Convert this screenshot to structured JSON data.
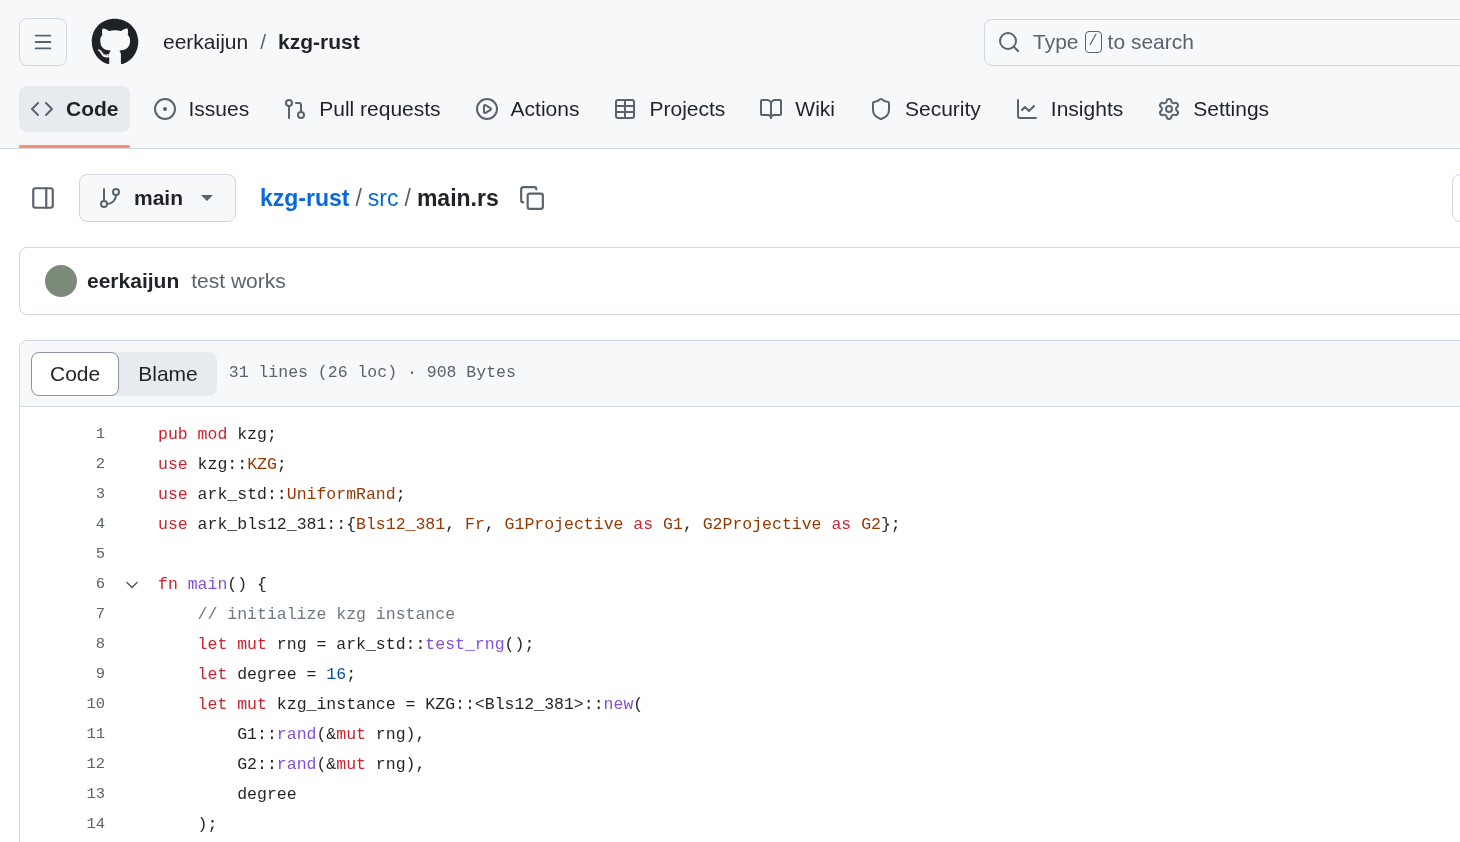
{
  "header": {
    "owner": "eerkaijun",
    "separator": "/",
    "repo": "kzg-rust",
    "search": {
      "placeholder_before": "Type",
      "key": "/",
      "placeholder_after": "to search"
    }
  },
  "tabs": [
    {
      "label": "Code",
      "selected": true
    },
    {
      "label": "Issues",
      "selected": false
    },
    {
      "label": "Pull requests",
      "selected": false
    },
    {
      "label": "Actions",
      "selected": false
    },
    {
      "label": "Projects",
      "selected": false
    },
    {
      "label": "Wiki",
      "selected": false
    },
    {
      "label": "Security",
      "selected": false
    },
    {
      "label": "Insights",
      "selected": false
    },
    {
      "label": "Settings",
      "selected": false
    }
  ],
  "file_bar": {
    "branch": "main",
    "path": [
      {
        "text": "kzg-rust",
        "kind": "link"
      },
      {
        "text": "/",
        "kind": "sep"
      },
      {
        "text": "src",
        "kind": "link"
      },
      {
        "text": "/",
        "kind": "sep"
      },
      {
        "text": "main.rs",
        "kind": "current"
      }
    ]
  },
  "commit": {
    "author": "eerkaijun",
    "message": "test works"
  },
  "viewer": {
    "modes": [
      {
        "label": "Code",
        "selected": true
      },
      {
        "label": "Blame",
        "selected": false
      }
    ],
    "meta": "31 lines (26 loc) · 908 Bytes",
    "lines": [
      {
        "number": "1",
        "foldable": false,
        "tokens": [
          {
            "text": "pub mod",
            "kind": "kw"
          },
          {
            "text": " kzg;",
            "kind": "plain"
          }
        ]
      },
      {
        "number": "2",
        "foldable": false,
        "tokens": [
          {
            "text": "use",
            "kind": "kw"
          },
          {
            "text": " kzg::",
            "kind": "plain"
          },
          {
            "text": "KZG",
            "kind": "type"
          },
          {
            "text": ";",
            "kind": "plain"
          }
        ]
      },
      {
        "number": "3",
        "foldable": false,
        "tokens": [
          {
            "text": "use",
            "kind": "kw"
          },
          {
            "text": " ark_std::",
            "kind": "plain"
          },
          {
            "text": "UniformRand",
            "kind": "type"
          },
          {
            "text": ";",
            "kind": "plain"
          }
        ]
      },
      {
        "number": "4",
        "foldable": false,
        "tokens": [
          {
            "text": "use",
            "kind": "kw"
          },
          {
            "text": " ark_bls12_381::{",
            "kind": "plain"
          },
          {
            "text": "Bls12_381",
            "kind": "type"
          },
          {
            "text": ", ",
            "kind": "plain"
          },
          {
            "text": "Fr",
            "kind": "type"
          },
          {
            "text": ", ",
            "kind": "plain"
          },
          {
            "text": "G1Projective",
            "kind": "type"
          },
          {
            "text": " as",
            "kind": "kw"
          },
          {
            "text": " G1",
            "kind": "type"
          },
          {
            "text": ", ",
            "kind": "plain"
          },
          {
            "text": "G2Projective",
            "kind": "type"
          },
          {
            "text": " as",
            "kind": "kw"
          },
          {
            "text": " G2",
            "kind": "type"
          },
          {
            "text": "};",
            "kind": "plain"
          }
        ]
      },
      {
        "number": "5",
        "foldable": false
      },
      {
        "number": "6",
        "foldable": true,
        "tokens": [
          {
            "text": "fn",
            "kind": "kw"
          },
          {
            "text": " main",
            "kind": "fn"
          },
          {
            "text": "() {",
            "kind": "plain"
          }
        ]
      },
      {
        "number": "7",
        "foldable": false,
        "tokens": [
          {
            "text": "    // initialize kzg instance",
            "kind": "comment"
          }
        ]
      },
      {
        "number": "8",
        "foldable": false,
        "tokens": [
          {
            "text": "    let mut",
            "kind": "kw"
          },
          {
            "text": " rng = ark_std::",
            "kind": "plain"
          },
          {
            "text": "test_rng",
            "kind": "fn"
          },
          {
            "text": "();",
            "kind": "plain"
          }
        ]
      },
      {
        "number": "9",
        "foldable": false,
        "tokens": [
          {
            "text": "    let",
            "kind": "kw"
          },
          {
            "text": " degree = ",
            "kind": "plain"
          },
          {
            "text": "16",
            "kind": "num"
          },
          {
            "text": ";",
            "kind": "plain"
          }
        ]
      },
      {
        "number": "10",
        "foldable": false,
        "tokens": [
          {
            "text": "    let mut",
            "kind": "kw"
          },
          {
            "text": " kzg_instance = KZG::<Bls12_381>::",
            "kind": "plain"
          },
          {
            "text": "new",
            "kind": "fn"
          },
          {
            "text": "(",
            "kind": "plain"
          }
        ]
      },
      {
        "number": "11",
        "foldable": false,
        "tokens": [
          {
            "text": "        G1::",
            "kind": "plain"
          },
          {
            "text": "rand",
            "kind": "fn"
          },
          {
            "text": "(&",
            "kind": "plain"
          },
          {
            "text": "mut",
            "kind": "kw"
          },
          {
            "text": " rng),",
            "kind": "plain"
          }
        ]
      },
      {
        "number": "12",
        "foldable": false,
        "tokens": [
          {
            "text": "        G2::",
            "kind": "plain"
          },
          {
            "text": "rand",
            "kind": "fn"
          },
          {
            "text": "(&",
            "kind": "plain"
          },
          {
            "text": "mut",
            "kind": "kw"
          },
          {
            "text": " rng),",
            "kind": "plain"
          }
        ]
      },
      {
        "number": "13",
        "foldable": false,
        "tokens": [
          {
            "text": "        degree",
            "kind": "plain"
          }
        ]
      },
      {
        "number": "14",
        "foldable": false,
        "tokens": [
          {
            "text": "    );",
            "kind": "plain"
          }
        ]
      }
    ]
  }
}
